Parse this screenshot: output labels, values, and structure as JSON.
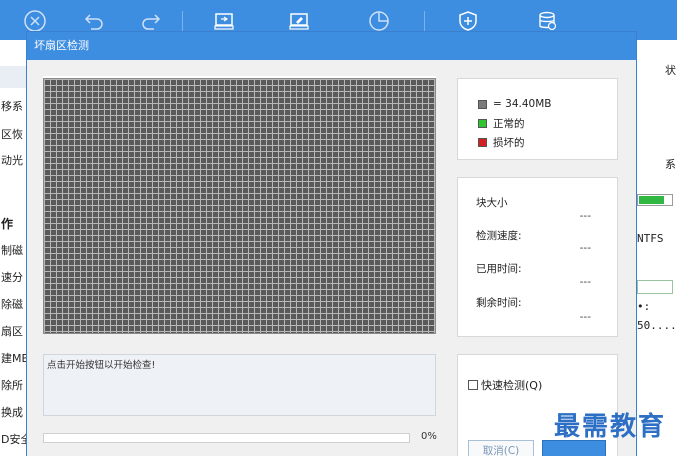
{
  "app": {
    "toolbar": {
      "icons": [
        "close-circle-icon",
        "undo-icon",
        "redo-icon",
        "disk-icon",
        "disk-edit-icon",
        "pie-icon",
        "shield-icon",
        "database-icon"
      ]
    },
    "left_items": [
      "移系",
      "区恢",
      "动光",
      "作",
      "制磁",
      "速分",
      "除磁",
      "扇区",
      "建MB",
      "除所",
      "换成",
      "D安全"
    ],
    "right": {
      "top_label": "状",
      "mid_label": "系",
      "fs_label": "NTFS",
      "mark": "•:",
      "value": "50...."
    }
  },
  "dialog": {
    "title": "坏扇区检测",
    "legend": {
      "block_size": "= 34.40MB",
      "normal": "正常的",
      "damaged": "损坏的",
      "colors": {
        "block": "#7b7b7b",
        "normal": "#2fc52f",
        "damaged": "#d42020"
      }
    },
    "stats": {
      "block_size_label": "块大小",
      "block_size_value": "---",
      "speed_label": "检测速度:",
      "speed_value": "---",
      "elapsed_label": "已用时间:",
      "elapsed_value": "---",
      "remaining_label": "剩余时间:",
      "remaining_value": "---"
    },
    "message": "点击开始按钮以开始检查!",
    "progress": {
      "percent_value": 0,
      "percent_label": "0%"
    },
    "quick_check_label": "快速检测(Q)",
    "quick_check_checked": false,
    "cancel_label": "取消(C)",
    "start_label": ""
  },
  "watermark": "最需教育"
}
